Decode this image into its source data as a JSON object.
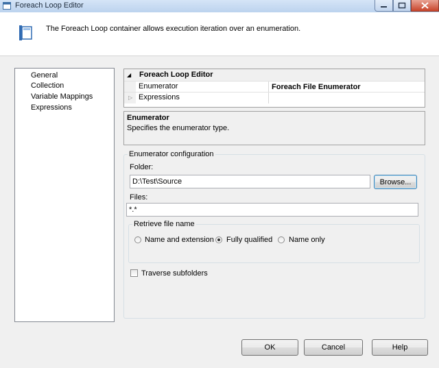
{
  "window": {
    "title": "Foreach Loop Editor"
  },
  "header": {
    "description": "The Foreach Loop container allows execution iteration over an enumeration."
  },
  "nav": {
    "items": [
      "General",
      "Collection",
      "Variable Mappings",
      "Expressions"
    ]
  },
  "property_grid": {
    "category": "Foreach Loop Editor",
    "rows": [
      {
        "name": "Enumerator",
        "value": "Foreach File Enumerator"
      },
      {
        "name": "Expressions",
        "value": ""
      }
    ]
  },
  "help": {
    "title": "Enumerator",
    "text": "Specifies the enumerator type."
  },
  "config": {
    "group_label": "Enumerator configuration",
    "folder_label": "Folder:",
    "folder_value": "D:\\Test\\Source",
    "browse_label": "Browse...",
    "files_label": "Files:",
    "files_value": "*.*",
    "retrieve_label": "Retrieve file name",
    "options": [
      "Name and extension",
      "Fully qualified",
      "Name only"
    ],
    "selected_option": "Fully qualified",
    "traverse_label": "Traverse subfolders",
    "traverse_checked": false
  },
  "buttons": {
    "ok": "OK",
    "cancel": "Cancel",
    "help": "Help"
  }
}
